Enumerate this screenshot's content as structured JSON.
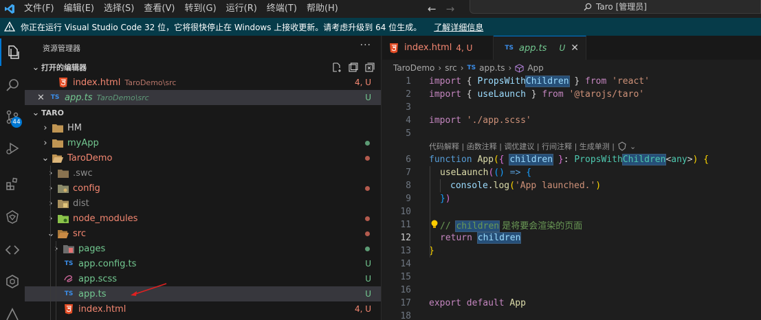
{
  "menu": [
    "文件(F)",
    "编辑(E)",
    "选择(S)",
    "查看(V)",
    "转到(G)",
    "运行(R)",
    "终端(T)",
    "帮助(H)"
  ],
  "search": {
    "text": "Taro [管理员]"
  },
  "banner": {
    "message": "你正在运行 Visual Studio Code 32 位，它将很快停止在 Windows 上接收更新。请考虑升级到 64 位生成。",
    "link": "了解详细信息"
  },
  "activity": {
    "badge": "44"
  },
  "explorer": {
    "title": "资源管理器",
    "more": "···",
    "open_editors": {
      "header": "打开的编辑器",
      "items": [
        {
          "name": "index.html",
          "path": "TaroDemo\\src",
          "status": "4, U"
        },
        {
          "name": "app.ts",
          "path": "TaroDemo\\src",
          "status": "U"
        }
      ]
    },
    "root": "TARO",
    "tree": [
      {
        "name": "HM"
      },
      {
        "name": "myApp"
      },
      {
        "name": "TaroDemo"
      },
      {
        "name": ".swc"
      },
      {
        "name": "config"
      },
      {
        "name": "dist"
      },
      {
        "name": "node_modules"
      },
      {
        "name": "src"
      },
      {
        "name": "pages"
      },
      {
        "name": "app.config.ts",
        "status": "U"
      },
      {
        "name": "app.scss",
        "status": "U"
      },
      {
        "name": "app.ts",
        "status": "U"
      },
      {
        "name": "index.html",
        "status": "4, U"
      }
    ]
  },
  "editor": {
    "tabs": [
      {
        "name": "index.html",
        "status": "4, U"
      },
      {
        "name": "app.ts",
        "status": "U"
      }
    ],
    "breadcrumb": [
      "TaroDemo",
      "src",
      "app.ts",
      "App"
    ],
    "codelens": "代码解释 | 函数注释 | 调优建议 | 行间注释 | 生成单测 |",
    "line_numbers": [
      "1",
      "2",
      "3",
      "4",
      "5",
      "6",
      "7",
      "8",
      "9",
      "10",
      "11",
      "12",
      "13",
      "14",
      "15",
      "16",
      "17",
      "18"
    ],
    "code": {
      "l1": [
        "import",
        "{",
        "PropsWith",
        "Children",
        "}",
        "from",
        "'react'"
      ],
      "l2": [
        "import",
        "{",
        "useLaunch",
        "}",
        "from",
        "'@tarojs/taro'"
      ],
      "l4": [
        "import",
        "'./app.scss'"
      ],
      "l6": [
        "function",
        "App",
        "(",
        "{",
        "children",
        "}",
        ":",
        "PropsWith",
        "Children",
        "<",
        "any",
        ">",
        ")",
        "{"
      ],
      "l7": [
        "useLaunch",
        "(",
        "()",
        "=>",
        "{"
      ],
      "l8": [
        "console",
        ".",
        "log",
        "(",
        "'App launched.'",
        ")"
      ],
      "l9": [
        "}",
        ")"
      ],
      "l11": [
        "// ",
        "children",
        " 是将要会渲染的页面"
      ],
      "l12": [
        "return",
        "children"
      ],
      "l13": [
        "}"
      ],
      "l17": [
        "export",
        "default",
        "App"
      ]
    }
  },
  "colors": {
    "accent": "#0078d4",
    "untracked": "#73c991",
    "error": "#f48771",
    "banner": "#063b49"
  }
}
